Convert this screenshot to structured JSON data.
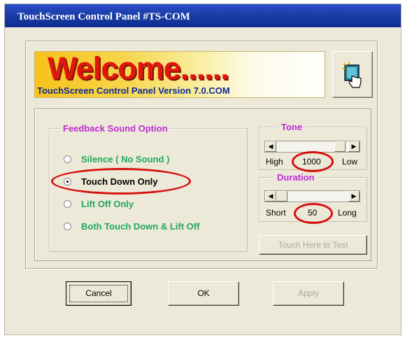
{
  "window": {
    "title": "TouchScreen Control Panel #TS-COM"
  },
  "banner": {
    "welcome": "Welcome......",
    "version": "TouchScreen Control Panel Version 7.0.COM"
  },
  "feedback": {
    "legend": "Feedback Sound Option",
    "options": [
      {
        "label": "Silence ( No Sound )",
        "checked": false
      },
      {
        "label": "Touch Down Only",
        "checked": true
      },
      {
        "label": "Lift Off Only",
        "checked": false
      },
      {
        "label": "Both Touch Down & Lift Off",
        "checked": false
      }
    ]
  },
  "tone": {
    "legend": "Tone",
    "left_caption": "High",
    "value": "1000",
    "right_caption": "Low"
  },
  "duration": {
    "legend": "Duration",
    "left_caption": "Short",
    "value": "50",
    "right_caption": "Long"
  },
  "test_button": {
    "label": "Touch Here to Test"
  },
  "buttons": {
    "cancel": "Cancel",
    "ok": "OK",
    "apply": "Apply"
  },
  "icons": {
    "app_icon": "touch-hand-icon",
    "left_arrow": "◀",
    "right_arrow": "▶"
  },
  "colors": {
    "highlight_ellipse": "#d80f0f",
    "legend": "#c02ad4",
    "option_text": "#21a85a",
    "title_bar": "#1a3da8"
  }
}
